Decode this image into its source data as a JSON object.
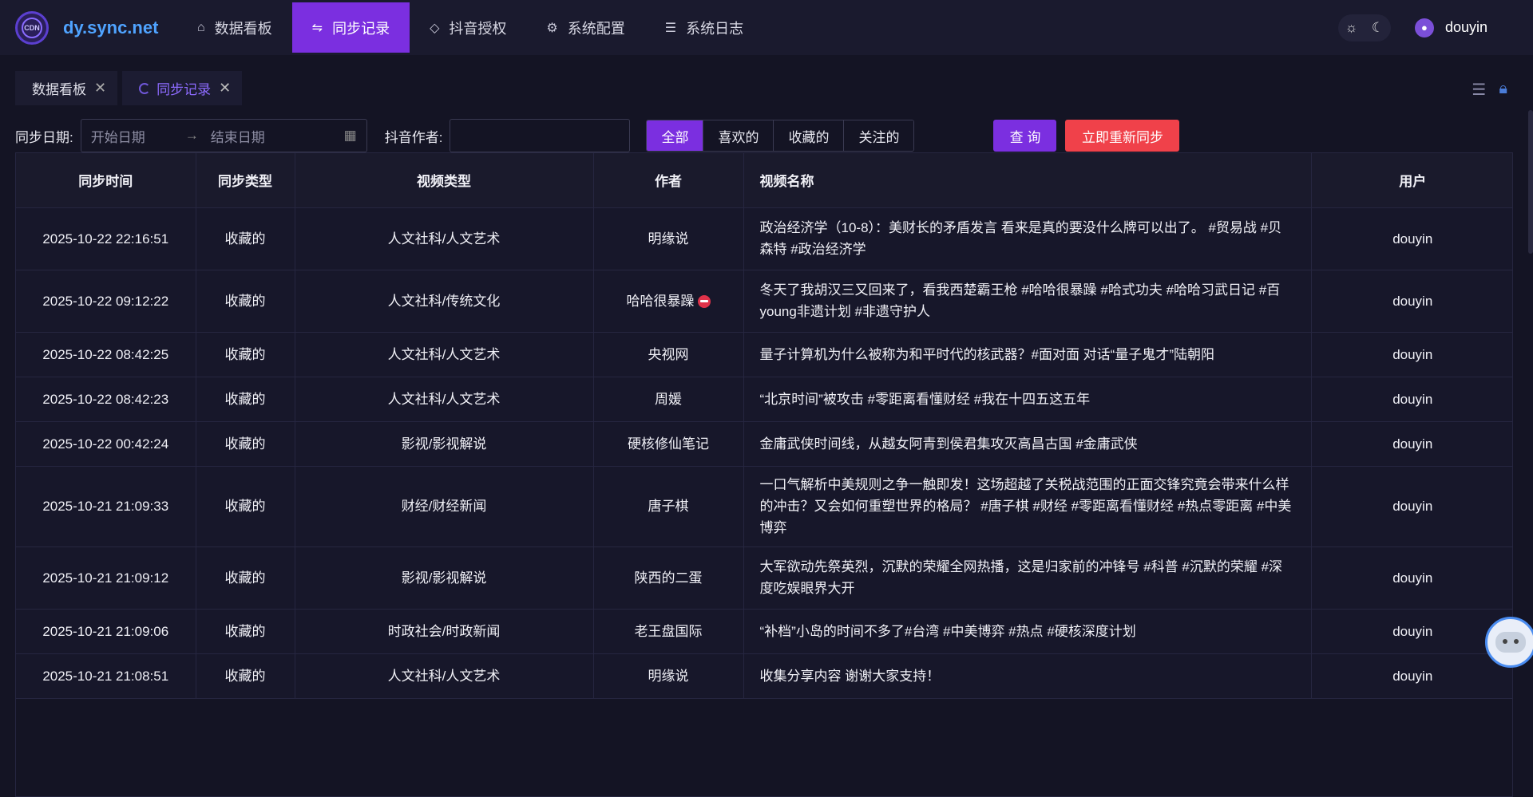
{
  "app": {
    "logo_badge": "CDN",
    "title": "dy.sync.net"
  },
  "nav": [
    {
      "icon": "dashboard-icon",
      "glyph": "⌂",
      "label": "数据看板",
      "active": false
    },
    {
      "icon": "sync-icon",
      "glyph": "⇋",
      "label": "同步记录",
      "active": true
    },
    {
      "icon": "shield-icon",
      "glyph": "◇",
      "label": "抖音授权",
      "active": false
    },
    {
      "icon": "gear-icon",
      "glyph": "⚙",
      "label": "系统配置",
      "active": false
    },
    {
      "icon": "list-icon",
      "glyph": "☰",
      "label": "系统日志",
      "active": false
    }
  ],
  "user": {
    "name": "douyin"
  },
  "tabs": [
    {
      "label": "数据看板",
      "active": false
    },
    {
      "label": "同步记录",
      "active": true
    }
  ],
  "filters": {
    "date_label": "同步日期:",
    "start_placeholder": "开始日期",
    "end_placeholder": "结束日期",
    "author_label": "抖音作者:",
    "author_value": "",
    "segments": [
      {
        "label": "全部",
        "active": true
      },
      {
        "label": "喜欢的",
        "active": false
      },
      {
        "label": "收藏的",
        "active": false
      },
      {
        "label": "关注的",
        "active": false
      }
    ],
    "query_label": "查 询",
    "resync_label": "立即重新同步"
  },
  "table": {
    "headers": [
      "同步时间",
      "同步类型",
      "视频类型",
      "作者",
      "视频名称",
      "用户"
    ],
    "rows": [
      {
        "time": "2025-10-22 22:16:51",
        "type": "收藏的",
        "category": "人文社科/人文艺术",
        "author": "明缘说",
        "title": "政治经济学（10-8）：美财长的矛盾发言 看来是真的要没什么牌可以出了。 #贸易战 #贝森特 #政治经济学",
        "user": "douyin",
        "h": 78
      },
      {
        "time": "2025-10-22 09:12:22",
        "type": "收藏的",
        "category": "人文社科/传统文化",
        "author": "哈哈很暴躁",
        "title": "冬天了我胡汉三又回来了，看我西楚霸王枪 #哈哈很暴躁 #哈式功夫 #哈哈习武日记 #百young非遗计划 #非遗守护人",
        "user": "douyin",
        "h": 78,
        "emoji": true
      },
      {
        "time": "2025-10-22 08:42:25",
        "type": "收藏的",
        "category": "人文社科/人文艺术",
        "author": "央视网",
        "title": "量子计算机为什么被称为和平时代的核武器？#面对面 对话“量子鬼才”陆朝阳",
        "user": "douyin",
        "h": 56
      },
      {
        "time": "2025-10-22 08:42:23",
        "type": "收藏的",
        "category": "人文社科/人文艺术",
        "author": "周媛",
        "title": "“北京时间”被攻击 #零距离看懂财经 #我在十四五这五年",
        "user": "douyin",
        "h": 56
      },
      {
        "time": "2025-10-22 00:42:24",
        "type": "收藏的",
        "category": "影视/影视解说",
        "author": "硬核修仙笔记",
        "title": "金庸武侠时间线，从越女阿青到侯君集攻灭高昌古国 #金庸武侠",
        "user": "douyin",
        "h": 56
      },
      {
        "time": "2025-10-21 21:09:33",
        "type": "收藏的",
        "category": "财经/财经新闻",
        "author": "唐子棋",
        "title": "一口气解析中美规则之争一触即发！这场超越了关税战范围的正面交锋究竟会带来什么样的冲击？又会如何重塑世界的格局？ #唐子棋 #财经 #零距离看懂财经 #热点零距离 #中美博弈",
        "user": "douyin",
        "h": 101
      },
      {
        "time": "2025-10-21 21:09:12",
        "type": "收藏的",
        "category": "影视/影视解说",
        "author": "陕西的二蛋",
        "title": "大军欲动先祭英烈，沉默的荣耀全网热播，这是归家前的冲锋号 #科普 #沉默的荣耀 #深度吃娱眼界大开",
        "user": "douyin",
        "h": 78
      },
      {
        "time": "2025-10-21 21:09:06",
        "type": "收藏的",
        "category": "时政社会/时政新闻",
        "author": "老王盘国际",
        "title": "“补档”小岛的时间不多了#台湾 #中美博弈 #热点 #硬核深度计划",
        "user": "douyin",
        "h": 56
      },
      {
        "time": "2025-10-21 21:08:51",
        "type": "收藏的",
        "category": "人文社科/人文艺术",
        "author": "明缘说",
        "title": "收集分享内容 谢谢大家支持！",
        "user": "douyin",
        "h": 56
      }
    ]
  }
}
